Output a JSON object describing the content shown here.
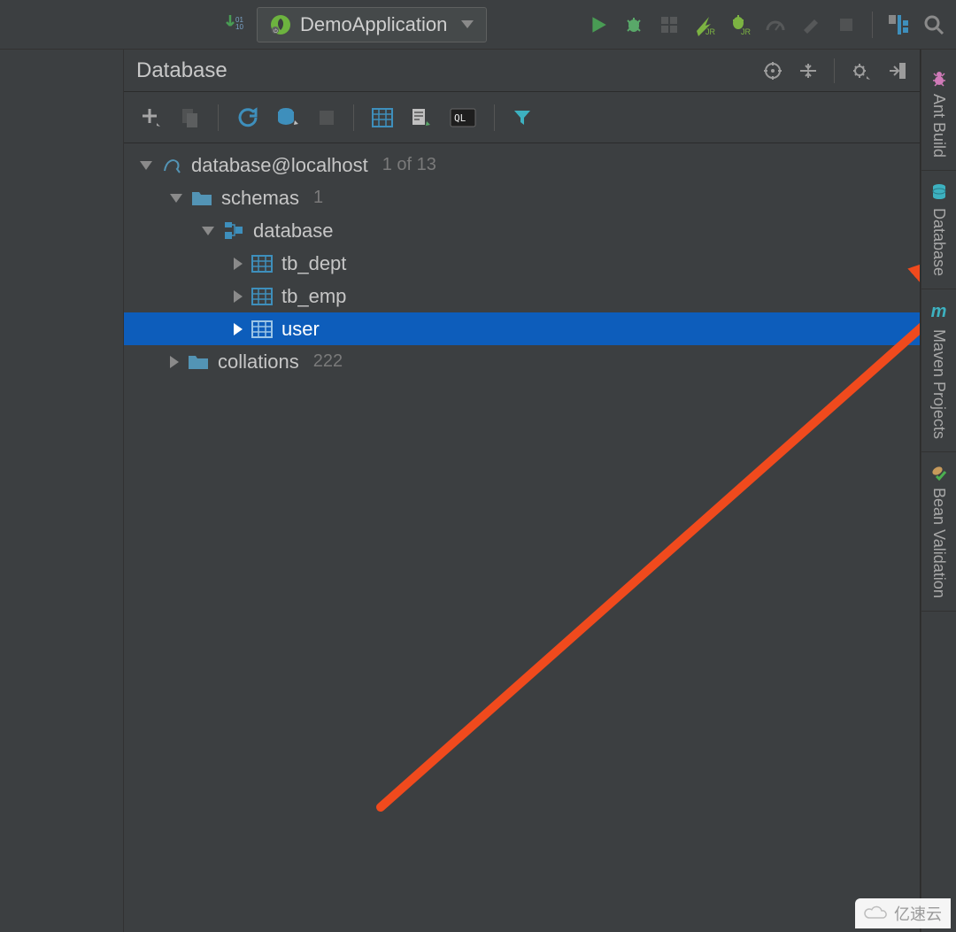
{
  "toolbar": {
    "run_config_label": "DemoApplication"
  },
  "panel": {
    "title": "Database"
  },
  "tree": {
    "root": {
      "label": "database@localhost",
      "count": "1 of 13"
    },
    "schemas": {
      "label": "schemas",
      "count": "1"
    },
    "db": {
      "label": "database"
    },
    "tables": [
      {
        "label": "tb_dept"
      },
      {
        "label": "tb_emp"
      },
      {
        "label": "user"
      }
    ],
    "collations": {
      "label": "collations",
      "count": "222"
    }
  },
  "sidebar": {
    "items": [
      {
        "label": "Ant Build"
      },
      {
        "label": "Database"
      },
      {
        "label": "Maven Projects"
      },
      {
        "label": "Bean Validation"
      }
    ]
  },
  "watermark": {
    "text": "亿速云"
  },
  "colors": {
    "selection": "#0d5dbb",
    "accent_orange": "#f04a1d",
    "icon_blue": "#3e8fbc",
    "icon_teal": "#3db1c0",
    "spring_green": "#6db33f",
    "run_green": "#499C54",
    "bug_green": "#59a869"
  }
}
